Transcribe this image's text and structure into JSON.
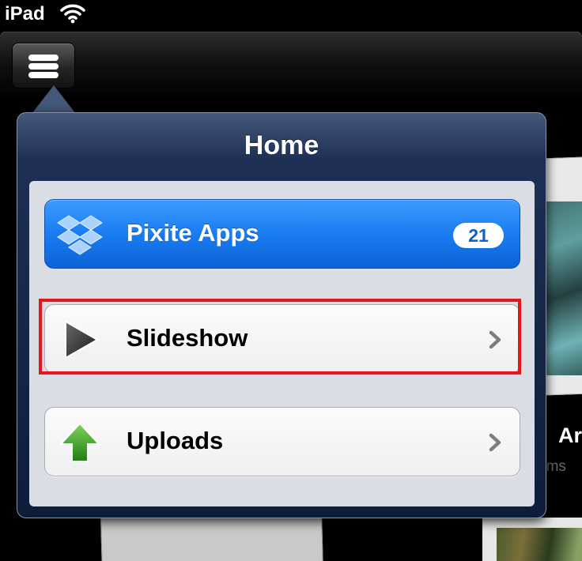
{
  "status_bar": {
    "carrier": "iPad",
    "wifi_icon": "wifi-icon"
  },
  "toolbar": {
    "menu_icon": "hamburger-menu-icon"
  },
  "background": {
    "title_fragment": "Ar",
    "subtitle_fragment": "ems"
  },
  "popover": {
    "title": "Home",
    "items": [
      {
        "label": "Pixite Apps",
        "icon": "dropbox-icon",
        "badge": "21",
        "selected": true
      },
      {
        "label": "Slideshow",
        "icon": "play-icon",
        "accessory": "chevron-right-icon"
      },
      {
        "label": "Uploads",
        "icon": "upload-arrow-icon",
        "accessory": "chevron-right-icon"
      }
    ]
  },
  "colors": {
    "selected_row": "#1a7cf2",
    "highlight_outline": "#e8141c",
    "popover_header": "#1d2f53",
    "upload_arrow": "#2e9a1e"
  }
}
